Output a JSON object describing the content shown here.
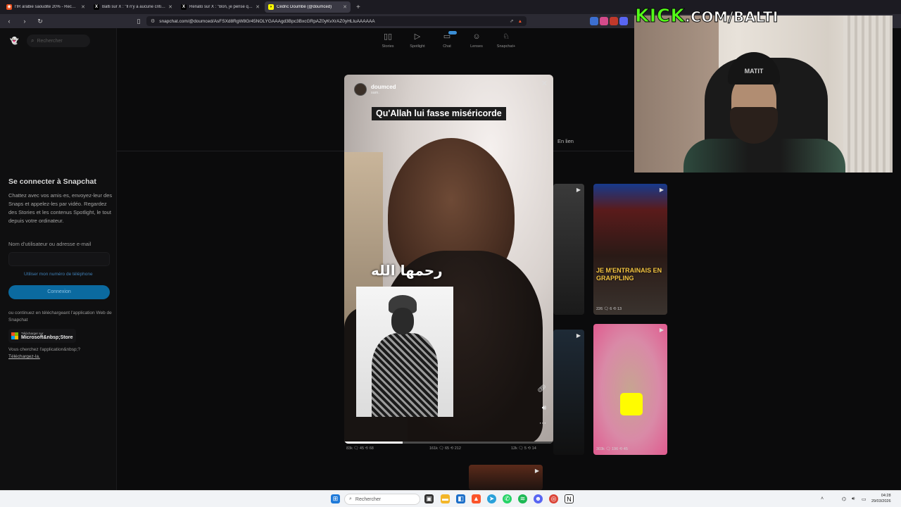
{
  "browser": {
    "tabs": [
      {
        "title": "l'IR arabie saoudite 20% - Recherche",
        "fav_color": "#e94e1b",
        "fav_glyph": "◉"
      },
      {
        "title": "Balti sur X : \"Il n'y a aucune critique...\"",
        "fav_color": "#000000",
        "fav_glyph": "X"
      },
      {
        "title": "Renato sur X : \"Bon, je pense que l'e...\"",
        "fav_color": "#000000",
        "fav_glyph": "X"
      },
      {
        "title": "Cédric Doumbé (@doumced)",
        "fav_color": "#fffc00",
        "fav_glyph": "👻"
      }
    ],
    "url": "snapchat.com/@doumced/AsFSXd8RgW8Gr45NOLYGAAAgd3Bpc3BxcGRpAZ0yKvXrAZ0yHLluAAAAAA"
  },
  "sidebar": {
    "search_placeholder": "Rechercher",
    "login_title": "Se connecter à Snapchat",
    "login_desc": "Chattez avec vos amis·es, envoyez-leur des Snaps et appelez-les par vidéo. Regardez des Stories et les contenus Spotlight, le tout depuis votre ordinateur.",
    "field_label": "Nom d'utilisateur ou adresse e-mail",
    "phone_link": "Utiliser mon numéro de téléphone",
    "connect_label": "Connexion",
    "download_text": "ou continuez en téléchargeant l'application Web de Snapchat",
    "store_small": "Télécharger sur",
    "store_big": "Microsoft&nbsp;Store",
    "looking_text": "Vous cherchez l'application&nbsp;? ",
    "looking_link": "Téléchargez-la."
  },
  "topnav": [
    {
      "label": "Stories",
      "icon": "stories-icon"
    },
    {
      "label": "Spotlight",
      "icon": "spotlight-icon"
    },
    {
      "label": "Chat",
      "icon": "chat-icon"
    },
    {
      "label": "Lenses",
      "icon": "lenses-icon"
    },
    {
      "label": "Snapchat+",
      "icon": "snapchat-plus-icon"
    }
  ],
  "profile": {
    "tab_label": "En lien"
  },
  "tiles": [
    {
      "stats": "226 🗨 6 ⟲ 13",
      "overlay": "JE M'ENTRAINAIS EN GRAPPLING"
    },
    {
      "stats": "303k 🗨 196 ⟲ 45"
    },
    {
      "stats": "83k 🗨 45 ⟲ 68"
    },
    {
      "stats": "161k 🗨 65 ⟲ 212"
    },
    {
      "stats": "12k 🗨 5 ⟲ 14"
    }
  ],
  "snap": {
    "username": "doumced",
    "time": "sam.",
    "caption": "Qu'Allah lui fasse miséricorde",
    "arabic": "رحمها الله",
    "progress": 0.28
  },
  "stream": {
    "kick_brand": "KICK",
    "kick_rest": ".COM/BALTI",
    "beanie_text": "MATIT"
  },
  "taskbar": {
    "search_placeholder": "Rechercher",
    "time": "04:28",
    "date": "29/03/2026"
  }
}
